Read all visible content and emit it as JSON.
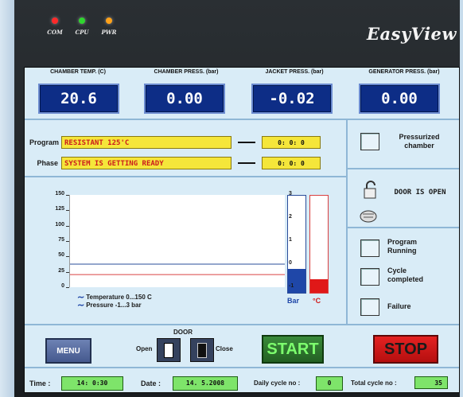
{
  "leds": [
    {
      "label": "COM",
      "color": "#ff2a2a"
    },
    {
      "label": "CPU",
      "color": "#2fd62f"
    },
    {
      "label": "PWR",
      "color": "#ffa21a"
    }
  ],
  "brand": "EasyView",
  "gauges": [
    {
      "label": "CHAMBER TEMP. (C)",
      "value": "20.6"
    },
    {
      "label": "CHAMBER PRESS. (bar)",
      "value": "0.00"
    },
    {
      "label": "JACKET PRESS. (bar)",
      "value": "-0.02"
    },
    {
      "label": "GENERATOR PRESS. (bar)",
      "value": "0.00"
    }
  ],
  "program": {
    "label": "Program",
    "value": "RESISTANT 125'C",
    "time": "0: 0: 0"
  },
  "phase": {
    "label": "Phase",
    "value": "SYSTEM IS GETTING READY",
    "time": "0: 0: 0"
  },
  "status": {
    "pressurized": "Pressurized chamber",
    "door": "DOOR IS OPEN",
    "program_running": "Program Running",
    "cycle_completed": "Cycle completed",
    "failure": "Failure"
  },
  "chart_data": {
    "type": "line",
    "left_axis_ticks": [
      "150",
      "125",
      "100",
      "75",
      "50",
      "25",
      "0"
    ],
    "right_axis_ticks": [
      "3",
      "2",
      "1",
      "0",
      "-1"
    ],
    "series": [
      {
        "name": "Temperature 0...150 C",
        "color": "#d94040",
        "values": [
          20.6,
          20.6
        ]
      },
      {
        "name": "Pressure -1...3 bar",
        "color": "#2a4c9a",
        "values": [
          0.0,
          0.0
        ]
      }
    ],
    "ylim_temperature": [
      0,
      150
    ],
    "ylim_pressure": [
      -1,
      3
    ],
    "legend_temperature": "Temperature 0...150 C",
    "legend_pressure": "Pressure -1...3 bar",
    "bar_label": "Bar",
    "deg_label": "°C",
    "bar_level_fraction": 0.25,
    "deg_level_fraction": 0.14
  },
  "door": {
    "title": "DOOR",
    "open_label": "Open",
    "close_label": "Close"
  },
  "buttons": {
    "menu": "MENU",
    "start": "START",
    "stop": "STOP"
  },
  "footer": {
    "time_label": "Time :",
    "time_value": "14: 0:30",
    "date_label": "Date :",
    "date_value": "14. 5.2008",
    "daily_label": "Daily cycle no :",
    "daily_value": "0",
    "total_label": "Total cycle no :",
    "total_value": "35"
  }
}
